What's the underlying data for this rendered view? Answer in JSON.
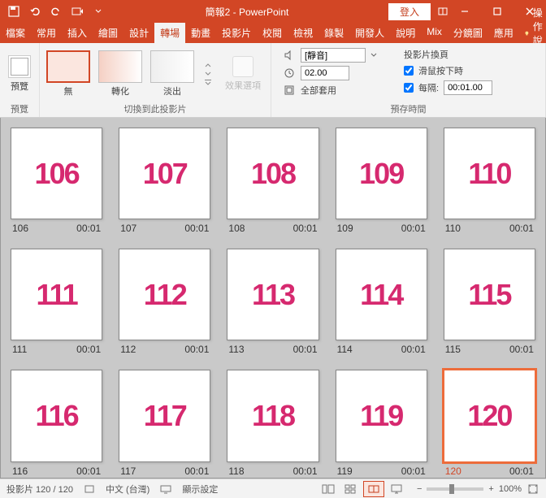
{
  "title": "簡報2 - PowerPoint",
  "login": "登入",
  "tabs": [
    "檔案",
    "常用",
    "插入",
    "繪圖",
    "設計",
    "轉場",
    "動畫",
    "投影片",
    "校閱",
    "檢視",
    "錄製",
    "開發人",
    "說明",
    "Mix",
    "分鏡圖",
    "應用"
  ],
  "active_tab": "轉場",
  "tell_me": "操作說明",
  "ribbon": {
    "preview": {
      "label": "預覽"
    },
    "transitions": {
      "label": "切換到此投影片",
      "items": [
        {
          "name": "無",
          "sel": true
        },
        {
          "name": "轉化"
        },
        {
          "name": "淡出"
        }
      ],
      "effect_options": "效果選項"
    },
    "timing": {
      "label": "預存時間",
      "sound_dropdown": "[靜音]",
      "duration_label": "",
      "duration_value": "02.00",
      "apply_all": "全部套用",
      "advance_header": "投影片換頁",
      "on_click": "滑鼠按下時",
      "after": "每隔:",
      "after_value": "00:01.00"
    }
  },
  "slides": [
    {
      "n": 106,
      "t": "00:01"
    },
    {
      "n": 107,
      "t": "00:01"
    },
    {
      "n": 108,
      "t": "00:01"
    },
    {
      "n": 109,
      "t": "00:01"
    },
    {
      "n": 110,
      "t": "00:01"
    },
    {
      "n": 111,
      "t": "00:01"
    },
    {
      "n": 112,
      "t": "00:01"
    },
    {
      "n": 113,
      "t": "00:01"
    },
    {
      "n": 114,
      "t": "00:01"
    },
    {
      "n": 115,
      "t": "00:01"
    },
    {
      "n": 116,
      "t": "00:01"
    },
    {
      "n": 117,
      "t": "00:01"
    },
    {
      "n": 118,
      "t": "00:01"
    },
    {
      "n": 119,
      "t": "00:01"
    },
    {
      "n": 120,
      "t": "00:01",
      "sel": true
    }
  ],
  "status": {
    "slide_counter": "投影片 120 / 120",
    "language": "中文 (台灣)",
    "display_settings": "顯示設定",
    "zoom": "100%"
  }
}
